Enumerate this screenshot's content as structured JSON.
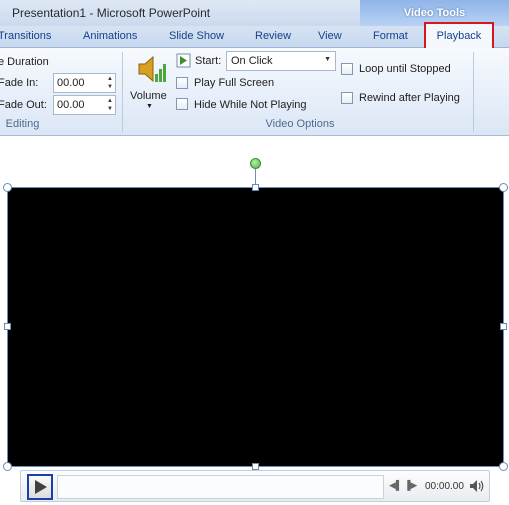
{
  "window": {
    "title": "Presentation1  -  Microsoft PowerPoint",
    "contextual_group": "Video Tools"
  },
  "tabs": {
    "transitions": "Transitions",
    "animations": "Animations",
    "slide_show": "Slide Show",
    "review": "Review",
    "view": "View",
    "format": "Format",
    "playback": "Playback"
  },
  "ribbon": {
    "editing": {
      "duration_label": "e Duration",
      "fade_in_label": "Fade In:",
      "fade_in_value": "00.00",
      "fade_out_label": "Fade Out:",
      "fade_out_value": "00.00",
      "group_label": "Editing"
    },
    "video_options": {
      "volume_label": "Volume",
      "start_label": "Start:",
      "start_value": "On Click",
      "play_full_screen": "Play Full Screen",
      "hide_while_not_playing": "Hide While Not Playing",
      "loop_until_stopped": "Loop until Stopped",
      "rewind_after_playing": "Rewind after Playing",
      "group_label": "Video Options"
    }
  },
  "player": {
    "time": "00:00.00"
  },
  "colors": {
    "highlight_tab_border": "#d4181d",
    "play_button_border": "#1b3fa8",
    "video_fill": "#000000"
  }
}
